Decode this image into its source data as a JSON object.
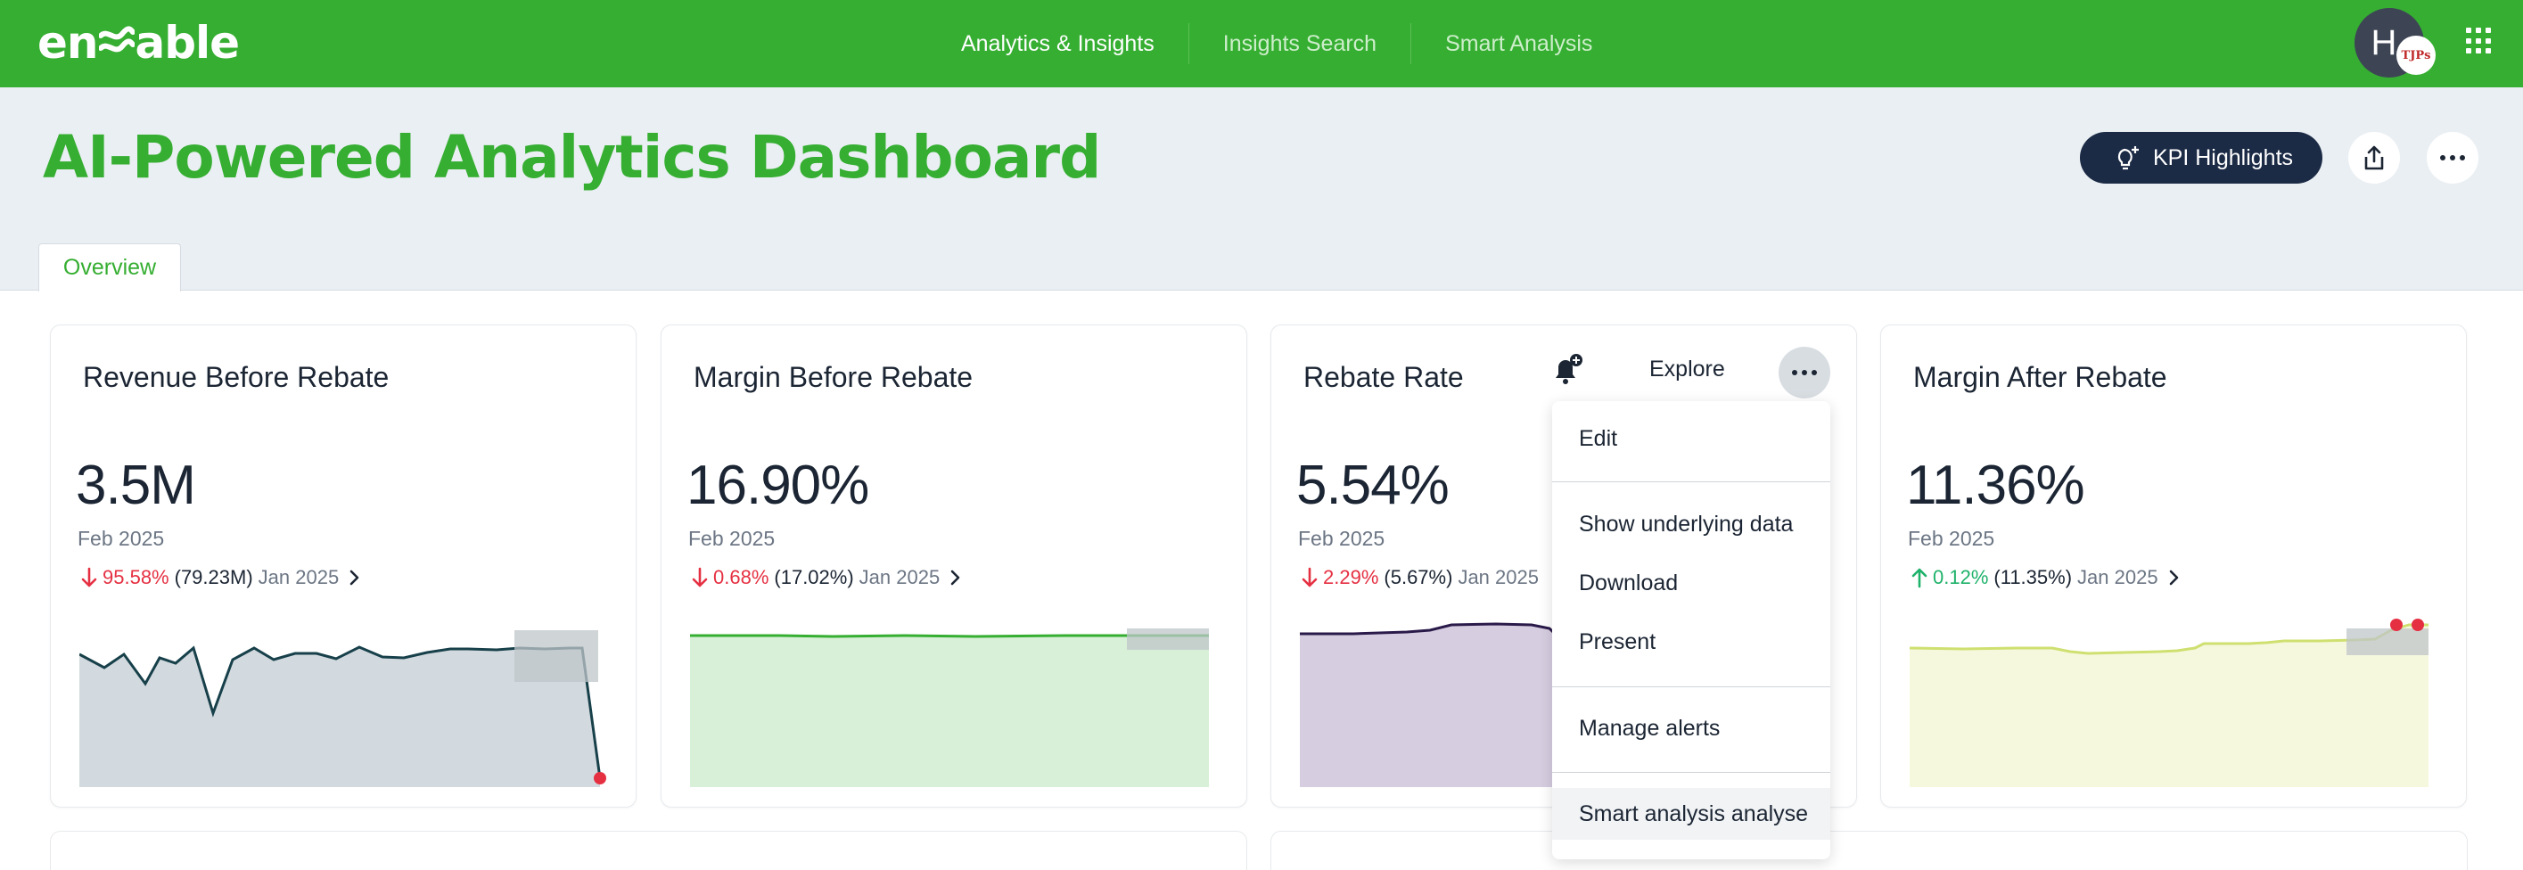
{
  "brand": {
    "logo_text": "enable",
    "logo_left": "en",
    "logo_right": "able"
  },
  "nav": {
    "items": [
      "Analytics & Insights",
      "Insights Search",
      "Smart Analysis"
    ]
  },
  "user": {
    "initial": "H",
    "badge": "TJPs"
  },
  "page": {
    "title": "AI-Powered Analytics Dashboard",
    "kpi_button": "KPI Highlights"
  },
  "tabs": [
    {
      "label": "Overview",
      "active": true
    }
  ],
  "cards": [
    {
      "title": "Revenue Before Rebate",
      "value": "3.5M",
      "period": "Feb 2025",
      "direction": "down",
      "change": "95.58%",
      "prev_value": "(79.23M)",
      "prev_period": "Jan 2025",
      "series_color": "#17404a",
      "fill_color": "#d3dadf"
    },
    {
      "title": "Margin Before Rebate",
      "value": "16.90%",
      "period": "Feb 2025",
      "direction": "down",
      "change": "0.68%",
      "prev_value": "(17.02%)",
      "prev_period": "Jan 2025",
      "series_color": "#35ae31",
      "fill_color": "#d8f0d7"
    },
    {
      "title": "Rebate Rate",
      "value": "5.54%",
      "period": "Feb 2025",
      "direction": "down",
      "change": "2.29%",
      "prev_value": "(5.67%)",
      "prev_period": "Jan 2025",
      "series_color": "#2a1a4a",
      "fill_color": "#d6cee0"
    },
    {
      "title": "Margin After Rebate",
      "value": "11.36%",
      "period": "Feb 2025",
      "direction": "up",
      "change": "0.12%",
      "prev_value": "(11.35%)",
      "prev_period": "Jan 2025",
      "series_color": "#cfe070",
      "fill_color": "#f6f8de"
    }
  ],
  "card_tools": {
    "explore": "Explore"
  },
  "menu": {
    "items": [
      "Edit",
      "Show underlying data",
      "Download",
      "Present",
      "Manage alerts",
      "Smart analysis analyse"
    ]
  },
  "colors": {
    "brand_green": "#36ae32",
    "header_bg": "#eaeff3",
    "dark_navy": "#1b2a45",
    "negative": "#e53042",
    "positive": "#1fb26a"
  },
  "icons": [
    "apps-grid-icon",
    "lightbulb-sparkle-icon",
    "share-icon",
    "more-icon",
    "bell-plus-icon",
    "arrow-down-icon",
    "arrow-up-icon",
    "chevron-right-icon"
  ]
}
